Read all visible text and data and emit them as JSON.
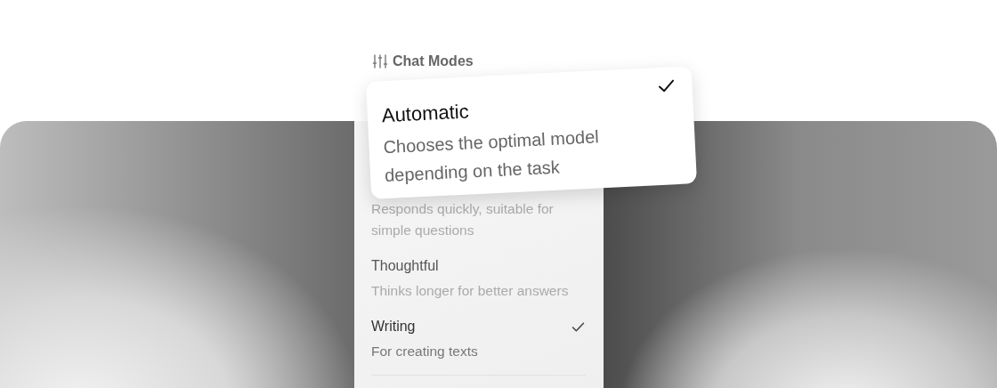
{
  "header": {
    "title": "Chat Modes"
  },
  "popup_card": {
    "title": "Automatic",
    "description": "Chooses the optimal model depending on the task",
    "selected": true
  },
  "modes": [
    {
      "description": "Responds quickly, suitable for simple questions",
      "selected": false
    },
    {
      "title": "Thoughtful",
      "description": "Thinks longer for better answers",
      "selected": false
    },
    {
      "title": "Writing",
      "description": "For creating texts",
      "selected": true
    }
  ]
}
